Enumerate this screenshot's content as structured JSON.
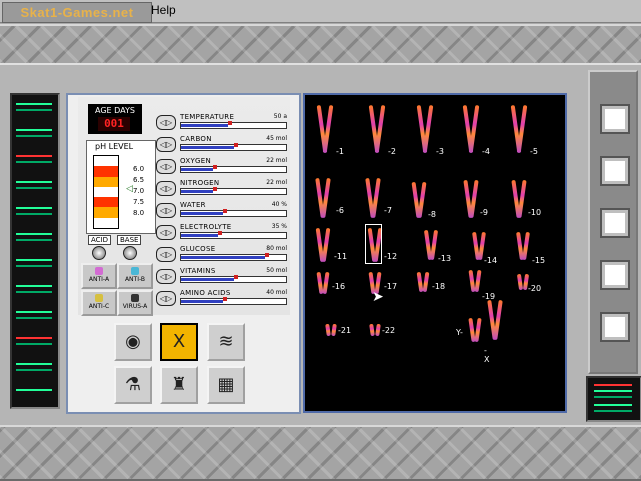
{
  "menu": {
    "logo_text": "Skat1-Games.net",
    "help": "Help"
  },
  "age_days": {
    "title": "AGE DAYS",
    "value": "001"
  },
  "ph": {
    "title": "pH LEVEL",
    "ticks": [
      "6.0",
      "6.5",
      "7.0",
      "7.5",
      "8.0"
    ],
    "acid_label": "ACID",
    "base_label": "BASE",
    "band_colors": [
      "#ffffff",
      "#ff3300",
      "#ffaa00",
      "#ffffff",
      "#ff3300",
      "#ffaa00",
      "#ffffff"
    ]
  },
  "antibodies": [
    {
      "label": "ANTI-A",
      "color": "#d36bd3"
    },
    {
      "label": "ANTI-B",
      "color": "#4ab7d6"
    },
    {
      "label": "ANTI-C",
      "color": "#d6c040"
    },
    {
      "label": "VIRUS-A",
      "color": "#333333"
    }
  ],
  "sensors": [
    {
      "name": "TEMPERATURE",
      "value": "50 a",
      "level": 0.45
    },
    {
      "name": "CARBON",
      "value": "45 mol",
      "level": 0.5
    },
    {
      "name": "OXYGEN",
      "value": "22 mol",
      "level": 0.3
    },
    {
      "name": "NITROGEN",
      "value": "22 mol",
      "level": 0.3
    },
    {
      "name": "WATER",
      "value": "40 %",
      "level": 0.4
    },
    {
      "name": "ELECTROLYTE",
      "value": "35 %",
      "level": 0.35
    },
    {
      "name": "GLUCOSE",
      "value": "80 mol",
      "level": 0.8
    },
    {
      "name": "VITAMINS",
      "value": "50 mol",
      "level": 0.5
    },
    {
      "name": "AMINO ACIDS",
      "value": "40 mol",
      "level": 0.4
    }
  ],
  "tools": [
    {
      "name": "cell-tool",
      "icon": "◉"
    },
    {
      "name": "chromosome-tool",
      "icon": "X"
    },
    {
      "name": "dna-tool",
      "icon": "≋"
    },
    {
      "name": "flask-tool",
      "icon": "⚗"
    },
    {
      "name": "microscope-tool",
      "icon": "♜"
    },
    {
      "name": "monitor-tool",
      "icon": "▦"
    }
  ],
  "chromosome_labels": [
    "1",
    "2",
    "3",
    "4",
    "5",
    "6",
    "7",
    "8",
    "9",
    "10",
    "11",
    "12",
    "13",
    "14",
    "15",
    "16",
    "17",
    "18",
    "19",
    "20",
    "21",
    "22",
    "Y",
    "X"
  ],
  "icons": {
    "pointer": "pointer-arrow-icon"
  }
}
